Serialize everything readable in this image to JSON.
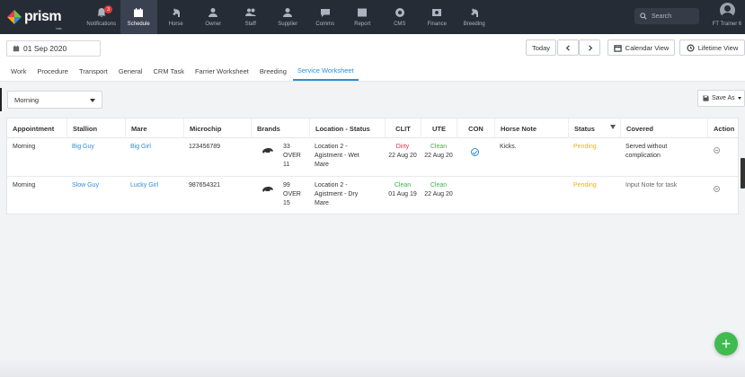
{
  "brand": {
    "name": "prism",
    "beta": "beta"
  },
  "nav": {
    "items": [
      {
        "label": "Notifications",
        "icon": "bell-icon",
        "badge": "3"
      },
      {
        "label": "Schedule",
        "icon": "calendar-icon",
        "active": true
      },
      {
        "label": "Horse",
        "icon": "horse-icon"
      },
      {
        "label": "Owner",
        "icon": "owner-icon"
      },
      {
        "label": "Staff",
        "icon": "staff-icon"
      },
      {
        "label": "Supplier",
        "icon": "supplier-icon"
      },
      {
        "label": "Comms",
        "icon": "comms-icon"
      },
      {
        "label": "Report",
        "icon": "report-icon"
      },
      {
        "label": "CMS",
        "icon": "cms-icon"
      },
      {
        "label": "Finance",
        "icon": "finance-icon"
      },
      {
        "label": "Breeding",
        "icon": "breeding-icon"
      }
    ],
    "search_placeholder": "Search",
    "user": "FT Trainer 6"
  },
  "header": {
    "date": "01 Sep 2020",
    "today_label": "Today",
    "calendar_view_label": "Calendar View",
    "lifetime_view_label": "Lifetime View",
    "tabs": [
      "Work",
      "Procedure",
      "Transport",
      "General",
      "CRM Task",
      "Farrier Worksheet",
      "Breeding",
      "Service Worksheet"
    ],
    "active_tab": "Service Worksheet"
  },
  "filter": {
    "selected": "Morning",
    "save_as_label": "Save As"
  },
  "table": {
    "columns": [
      "Appointment",
      "Stallion",
      "Mare",
      "Microchip",
      "Brands",
      "Location - Status",
      "CLIT",
      "UTE",
      "CON",
      "Horse Note",
      "Status",
      "Covered",
      "Action"
    ],
    "rows": [
      {
        "appointment": "Morning",
        "stallion": "Big Guy",
        "mare": "Big Girl",
        "microchip": "123456789",
        "brands": [
          "33",
          "OVER",
          "11"
        ],
        "location": [
          "Location 2 -",
          "Agistment - Wet",
          "Mare"
        ],
        "clit_status": "Dirty",
        "clit_date": "22 Aug 20",
        "ute_status": "Clean",
        "ute_date": "22 Aug 20",
        "con": true,
        "horse_note": "Kicks.",
        "status": "Pending",
        "covered": [
          "Served without",
          "complication"
        ]
      },
      {
        "appointment": "Morning",
        "stallion": "Slow Guy",
        "mare": "Lucky Girl",
        "microchip": "987654321",
        "brands": [
          "99",
          "OVER",
          "15"
        ],
        "location": [
          "Location 2 -",
          "Agistment - Dry",
          "Mare"
        ],
        "clit_status": "Clean",
        "clit_date": "01 Aug 19",
        "ute_status": "Clean",
        "ute_date": "22 Aug 20",
        "con": false,
        "horse_note": "",
        "status": "Pending",
        "covered": [
          "Input Note for task"
        ]
      }
    ]
  },
  "fab_label": "+",
  "colors": {
    "nav_bg": "#262c36",
    "accent": "#2f8fcf",
    "dirty": "#d9334a",
    "clean": "#3bb54a",
    "pending": "#e7b414",
    "fab": "#3fbb4f"
  }
}
